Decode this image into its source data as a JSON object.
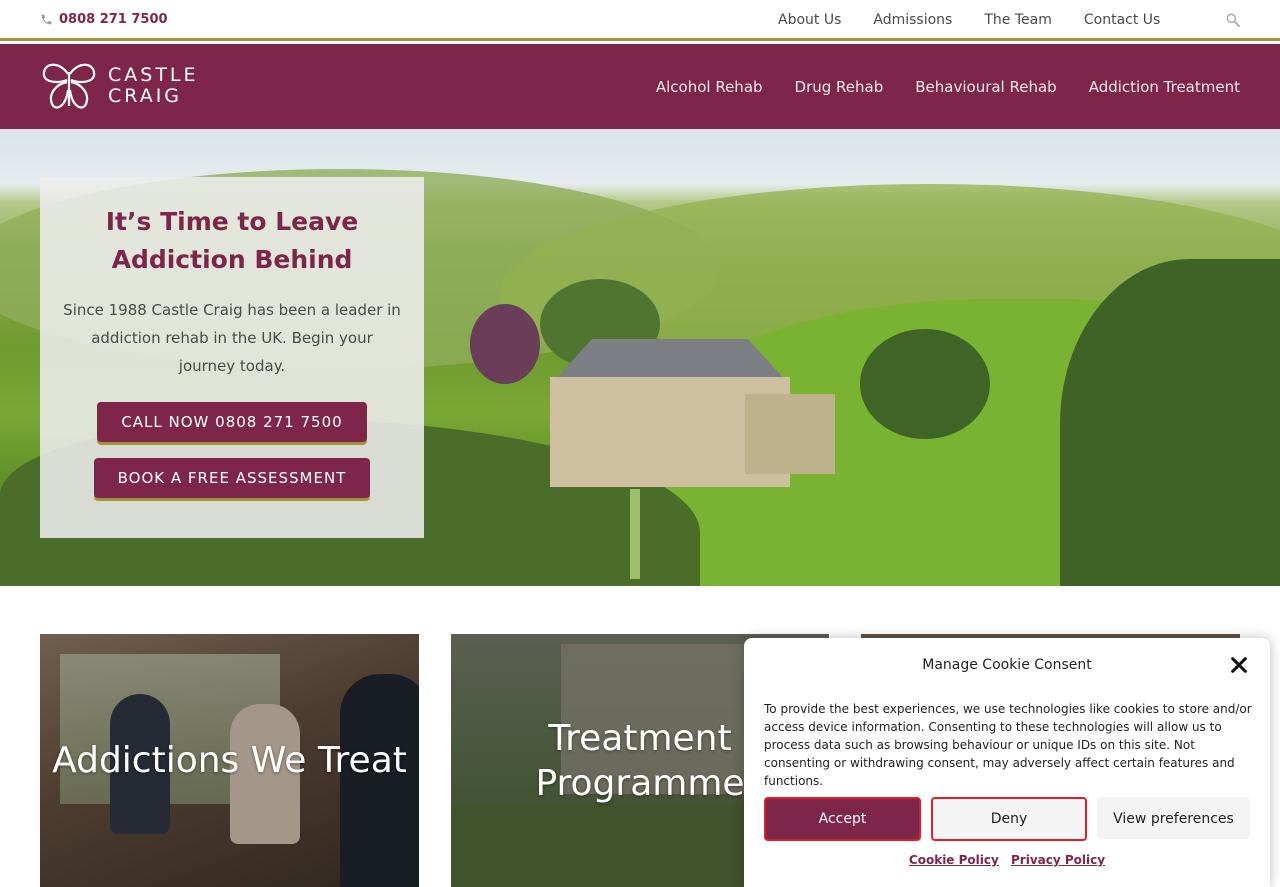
{
  "topbar": {
    "phone": "0808 271 7500",
    "links": [
      "About Us",
      "Admissions",
      "The Team",
      "Contact Us"
    ]
  },
  "brand": {
    "line1": "CASTLE",
    "line2": "CRAIG"
  },
  "mainnav": {
    "links": [
      "Alcohol Rehab",
      "Drug Rehab",
      "Behavioural Rehab",
      "Addiction Treatment"
    ]
  },
  "hero": {
    "title_line1": "It’s Time to Leave",
    "title_line2": "Addiction Behind",
    "text": "Since 1988 Castle Craig has been a leader in addiction rehab in the UK. Begin your journey today.",
    "call_button": "CALL NOW 0808 271 7500",
    "assess_button": "BOOK A FREE ASSESSMENT"
  },
  "tiles": [
    {
      "title": "Addictions We Treat"
    },
    {
      "title_line1": "Treatment",
      "title_line2": "Programme"
    },
    {
      "title": ""
    }
  ],
  "cookie": {
    "title": "Manage Cookie Consent",
    "text": "To provide the best experiences, we use technologies like cookies to store and/or access device information. Consenting to these technologies will allow us to process data such as browsing behaviour or unique IDs on this site. Not consenting or withdrawing consent, may adversely affect certain features and functions.",
    "accept": "Accept",
    "deny": "Deny",
    "preferences": "View preferences",
    "cookie_policy": "Cookie Policy",
    "privacy_policy": "Privacy Policy"
  },
  "colors": {
    "brand": "#7d2649",
    "accent_gold": "#a39437",
    "highlight_red": "#e01f2b"
  },
  "icons": [
    "phone-icon",
    "search-icon",
    "butterfly-logo-icon",
    "close-icon"
  ]
}
